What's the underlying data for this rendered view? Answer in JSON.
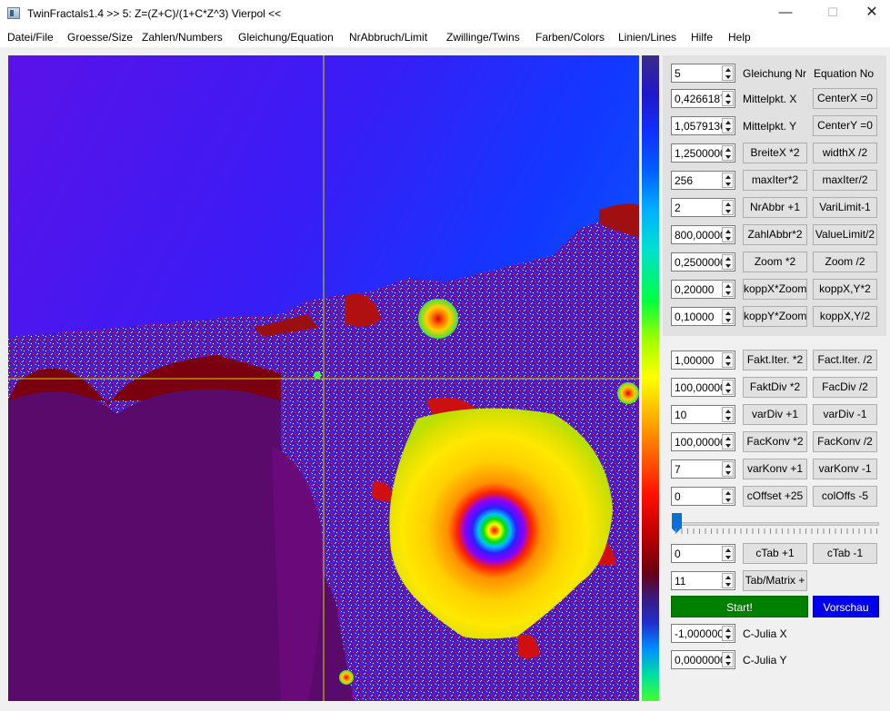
{
  "window": {
    "title": "TwinFractals1.4 >> 5: Z=(Z+C)/(1+C*Z^3) Vierpol <<",
    "minimize": "—",
    "maximize": "☐",
    "close": "✕"
  },
  "menu": [
    "Datei/File",
    "Groesse/Size",
    "Zahlen/Numbers",
    "Gleichung/Equation",
    "NrAbbruch/Limit",
    "Zwillinge/Twins",
    "Farben/Colors",
    "Linien/Lines",
    "Hilfe",
    "Help"
  ],
  "top_panel": {
    "equation": {
      "value": "5",
      "label_de": "Gleichung Nr",
      "label_en": "Equation No"
    },
    "center_x": {
      "value": "0,4266187(",
      "label": "Mittelpkt. X",
      "button": "CenterX =0"
    },
    "center_y": {
      "value": "1,0579136(",
      "label": "Mittelpkt. Y",
      "button": "CenterY =0"
    },
    "rows": [
      {
        "value": "1,2500000",
        "button1": "BreiteX *2",
        "button2": "widthX /2"
      },
      {
        "value": "256",
        "button1": "maxIter*2",
        "button2": "maxIter/2"
      },
      {
        "value": "2",
        "button1": "NrAbbr +1",
        "button2": "VariLimit-1"
      },
      {
        "value": "800,00000",
        "button1": "ZahlAbbr*2",
        "button2": "ValueLimit/2"
      },
      {
        "value": "0,2500000",
        "button1": "Zoom *2",
        "button2": "Zoom /2"
      },
      {
        "value": "0,20000",
        "button1": "koppX*Zoom",
        "button2": "koppX,Y*2"
      },
      {
        "value": "0,10000",
        "button1": "koppY*Zoom",
        "button2": "koppX,Y/2"
      }
    ]
  },
  "bottom_panel": {
    "rows": [
      {
        "value": "1,00000",
        "button1": "Fakt.Iter. *2",
        "button2": "Fact.Iter. /2"
      },
      {
        "value": "100,00000",
        "button1": "FaktDiv *2",
        "button2": "FacDiv /2"
      },
      {
        "value": "10",
        "button1": "varDiv +1",
        "button2": "varDiv -1"
      },
      {
        "value": "100,00000",
        "button1": "FacKonv *2",
        "button2": "FacKonv /2"
      },
      {
        "value": "7",
        "button1": "varKonv +1",
        "button2": "varKonv -1"
      },
      {
        "value": "0",
        "button1": "cOffset +25",
        "button2": "colOffs -5"
      }
    ],
    "slider_level": 0,
    "ctab": {
      "value": "0",
      "button1": "cTab +1",
      "button2": "cTab -1"
    },
    "tab_matrix": {
      "value": "11",
      "button": "Tab/Matrix +"
    },
    "start": "Start!",
    "preview": "Vorschau",
    "julia_x": {
      "value": "-1,000000(",
      "label": "C-Julia X"
    },
    "julia_y": {
      "value": "0,0000000(",
      "label": "C-Julia Y"
    }
  },
  "colors": {
    "start_button": "#008000",
    "preview_button": "#0000ee",
    "slider_accent": "#0a6fd6",
    "crosshair": "#d8d800"
  }
}
